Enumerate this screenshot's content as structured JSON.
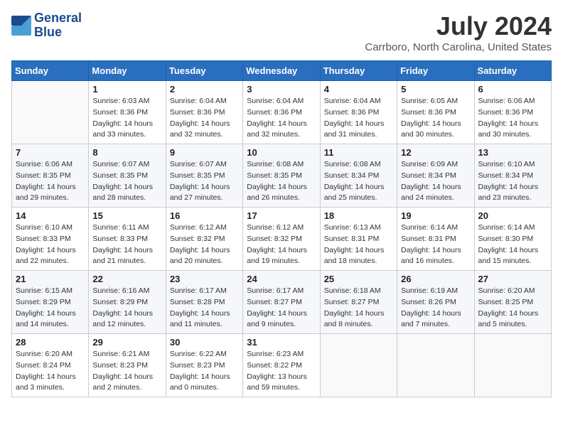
{
  "header": {
    "logo_line1": "General",
    "logo_line2": "Blue",
    "month": "July 2024",
    "location": "Carrboro, North Carolina, United States"
  },
  "days_of_week": [
    "Sunday",
    "Monday",
    "Tuesday",
    "Wednesday",
    "Thursday",
    "Friday",
    "Saturday"
  ],
  "weeks": [
    [
      {
        "day": "",
        "content": ""
      },
      {
        "day": "1",
        "content": "Sunrise: 6:03 AM\nSunset: 8:36 PM\nDaylight: 14 hours\nand 33 minutes."
      },
      {
        "day": "2",
        "content": "Sunrise: 6:04 AM\nSunset: 8:36 PM\nDaylight: 14 hours\nand 32 minutes."
      },
      {
        "day": "3",
        "content": "Sunrise: 6:04 AM\nSunset: 8:36 PM\nDaylight: 14 hours\nand 32 minutes."
      },
      {
        "day": "4",
        "content": "Sunrise: 6:04 AM\nSunset: 8:36 PM\nDaylight: 14 hours\nand 31 minutes."
      },
      {
        "day": "5",
        "content": "Sunrise: 6:05 AM\nSunset: 8:36 PM\nDaylight: 14 hours\nand 30 minutes."
      },
      {
        "day": "6",
        "content": "Sunrise: 6:06 AM\nSunset: 8:36 PM\nDaylight: 14 hours\nand 30 minutes."
      }
    ],
    [
      {
        "day": "7",
        "content": "Sunrise: 6:06 AM\nSunset: 8:35 PM\nDaylight: 14 hours\nand 29 minutes."
      },
      {
        "day": "8",
        "content": "Sunrise: 6:07 AM\nSunset: 8:35 PM\nDaylight: 14 hours\nand 28 minutes."
      },
      {
        "day": "9",
        "content": "Sunrise: 6:07 AM\nSunset: 8:35 PM\nDaylight: 14 hours\nand 27 minutes."
      },
      {
        "day": "10",
        "content": "Sunrise: 6:08 AM\nSunset: 8:35 PM\nDaylight: 14 hours\nand 26 minutes."
      },
      {
        "day": "11",
        "content": "Sunrise: 6:08 AM\nSunset: 8:34 PM\nDaylight: 14 hours\nand 25 minutes."
      },
      {
        "day": "12",
        "content": "Sunrise: 6:09 AM\nSunset: 8:34 PM\nDaylight: 14 hours\nand 24 minutes."
      },
      {
        "day": "13",
        "content": "Sunrise: 6:10 AM\nSunset: 8:34 PM\nDaylight: 14 hours\nand 23 minutes."
      }
    ],
    [
      {
        "day": "14",
        "content": "Sunrise: 6:10 AM\nSunset: 8:33 PM\nDaylight: 14 hours\nand 22 minutes."
      },
      {
        "day": "15",
        "content": "Sunrise: 6:11 AM\nSunset: 8:33 PM\nDaylight: 14 hours\nand 21 minutes."
      },
      {
        "day": "16",
        "content": "Sunrise: 6:12 AM\nSunset: 8:32 PM\nDaylight: 14 hours\nand 20 minutes."
      },
      {
        "day": "17",
        "content": "Sunrise: 6:12 AM\nSunset: 8:32 PM\nDaylight: 14 hours\nand 19 minutes."
      },
      {
        "day": "18",
        "content": "Sunrise: 6:13 AM\nSunset: 8:31 PM\nDaylight: 14 hours\nand 18 minutes."
      },
      {
        "day": "19",
        "content": "Sunrise: 6:14 AM\nSunset: 8:31 PM\nDaylight: 14 hours\nand 16 minutes."
      },
      {
        "day": "20",
        "content": "Sunrise: 6:14 AM\nSunset: 8:30 PM\nDaylight: 14 hours\nand 15 minutes."
      }
    ],
    [
      {
        "day": "21",
        "content": "Sunrise: 6:15 AM\nSunset: 8:29 PM\nDaylight: 14 hours\nand 14 minutes."
      },
      {
        "day": "22",
        "content": "Sunrise: 6:16 AM\nSunset: 8:29 PM\nDaylight: 14 hours\nand 12 minutes."
      },
      {
        "day": "23",
        "content": "Sunrise: 6:17 AM\nSunset: 8:28 PM\nDaylight: 14 hours\nand 11 minutes."
      },
      {
        "day": "24",
        "content": "Sunrise: 6:17 AM\nSunset: 8:27 PM\nDaylight: 14 hours\nand 9 minutes."
      },
      {
        "day": "25",
        "content": "Sunrise: 6:18 AM\nSunset: 8:27 PM\nDaylight: 14 hours\nand 8 minutes."
      },
      {
        "day": "26",
        "content": "Sunrise: 6:19 AM\nSunset: 8:26 PM\nDaylight: 14 hours\nand 7 minutes."
      },
      {
        "day": "27",
        "content": "Sunrise: 6:20 AM\nSunset: 8:25 PM\nDaylight: 14 hours\nand 5 minutes."
      }
    ],
    [
      {
        "day": "28",
        "content": "Sunrise: 6:20 AM\nSunset: 8:24 PM\nDaylight: 14 hours\nand 3 minutes."
      },
      {
        "day": "29",
        "content": "Sunrise: 6:21 AM\nSunset: 8:23 PM\nDaylight: 14 hours\nand 2 minutes."
      },
      {
        "day": "30",
        "content": "Sunrise: 6:22 AM\nSunset: 8:23 PM\nDaylight: 14 hours\nand 0 minutes."
      },
      {
        "day": "31",
        "content": "Sunrise: 6:23 AM\nSunset: 8:22 PM\nDaylight: 13 hours\nand 59 minutes."
      },
      {
        "day": "",
        "content": ""
      },
      {
        "day": "",
        "content": ""
      },
      {
        "day": "",
        "content": ""
      }
    ]
  ]
}
